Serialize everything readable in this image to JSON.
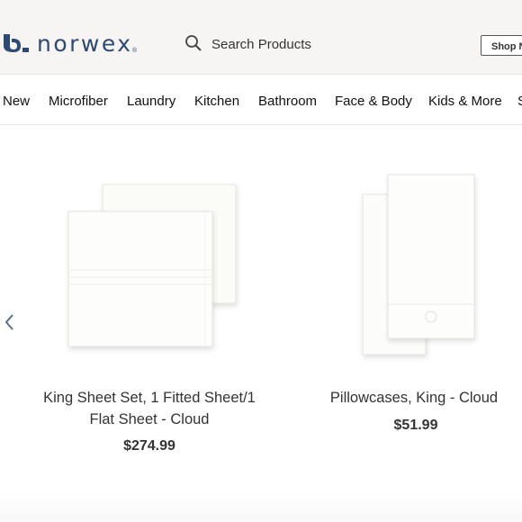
{
  "header": {
    "logo_text": "norwex",
    "logo_reg": "®",
    "search_placeholder": "Search Products",
    "shop_button": "Shop N"
  },
  "nav": {
    "items": [
      "New",
      "Microfiber",
      "Laundry",
      "Kitchen",
      "Bathroom",
      "Face & Body",
      "Kids & More",
      "S"
    ]
  },
  "products": [
    {
      "title_line1": "King Sheet Set, 1 Fitted Sheet/1",
      "title_line2": "Flat Sheet - Cloud",
      "price": "$274.99"
    },
    {
      "title_line1": "Pillowcases, King - Cloud",
      "price": "$51.99"
    }
  ],
  "icons": {
    "prev": "chevron-left-icon",
    "search": "search-icon",
    "logo": "norwex-logo-icon"
  },
  "colors": {
    "brand": "#2d4a73",
    "arrow": "#5b6f8a"
  }
}
